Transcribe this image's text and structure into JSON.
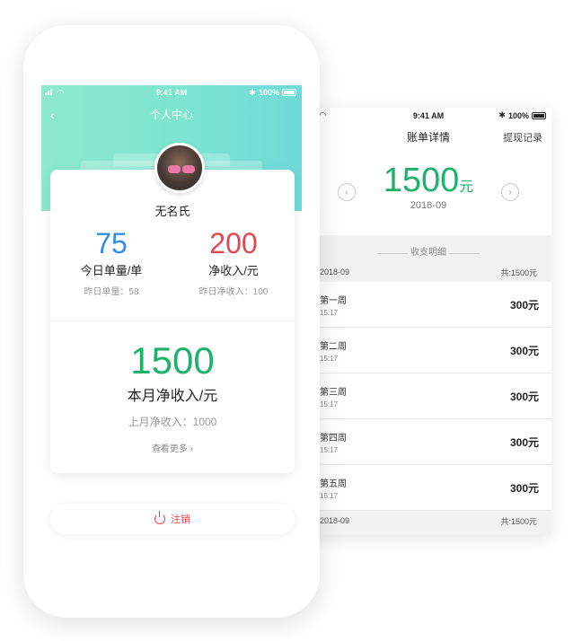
{
  "bill_screen": {
    "status": {
      "time": "9:41 AM",
      "battery": "100%"
    },
    "nav": {
      "title": "账单详情",
      "withdraw_label": "提现记录"
    },
    "summary": {
      "amount": "1500",
      "unit": "元",
      "month": "2018-09"
    },
    "section_title": "收支明细",
    "groups": [
      {
        "month": "2018-09",
        "total": "共:1500元",
        "rows": [
          {
            "week": "第一周",
            "time": "15:17",
            "amount": "300元"
          },
          {
            "week": "第二周",
            "time": "15:17",
            "amount": "300元"
          },
          {
            "week": "第三周",
            "time": "15:17",
            "amount": "300元"
          },
          {
            "week": "第四周",
            "time": "15:17",
            "amount": "300元"
          },
          {
            "week": "第五周",
            "time": "15:17",
            "amount": "300元"
          }
        ]
      },
      {
        "month": "2018-09",
        "total": "共:1500元"
      }
    ],
    "colors": {
      "accent": "#1fb26b"
    }
  },
  "profile_screen": {
    "status": {
      "time": "9:41 AM",
      "battery": "100%"
    },
    "nav": {
      "title": "个人中心"
    },
    "user": {
      "name": "无名氏"
    },
    "stats": {
      "orders": {
        "value": "75",
        "label": "今日单量/单",
        "sub": "昨日单量：58"
      },
      "income": {
        "value": "200",
        "label": "净收入/元",
        "sub": "昨日净收入：100"
      }
    },
    "month": {
      "value": "1500",
      "label": "本月净收入/元",
      "sub": "上月净收入：1000"
    },
    "more_label": "查看更多",
    "logout_label": "注销",
    "colors": {
      "hero_gradient": "#8ee9cc",
      "blue": "#2f8fe3",
      "red": "#e3474f",
      "green": "#1fb26b"
    }
  }
}
